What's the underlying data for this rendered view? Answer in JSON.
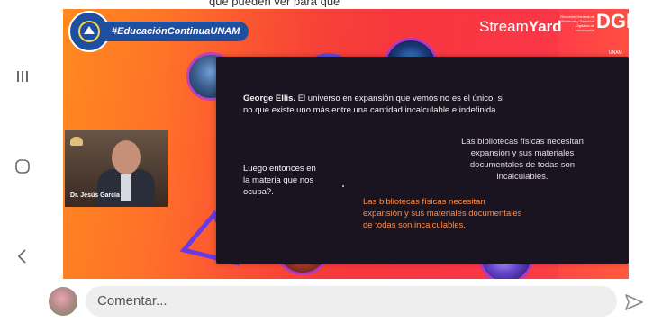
{
  "top_caption": "que pueden ver para que",
  "nav": {
    "recents_icon": "recent-apps-icon",
    "home_icon": "home-icon",
    "back_icon": "back-icon"
  },
  "stream": {
    "hashtag": "#EducaciónContinuaUNAM",
    "brand": "Stream",
    "brand_bold": "Yard",
    "dgb_text": "Dirección General de Bibliotecas y Servicios Digitales de Información",
    "dgb_logo": "DGB",
    "dgb_unam": "UNAM",
    "colors": {
      "orange": "#ff8a1f",
      "red": "#ff3d3d",
      "blue": "#1f4f9f",
      "slide_bg": "#1a1420"
    }
  },
  "slide": {
    "quote_author": "George Ellis.",
    "quote_body": " El universo en expansión que vemos no es el único, si no que existe uno más entre una cantidad incalculable e indefinida",
    "question": "Luego entonces en la materia que nos ocupa?.",
    "library_text_1": "Las bibliotecas físicas necesitan expansión y sus materiales documentales de todas son incalculables.",
    "library_text_2": "Las bibliotecas físicas necesitan expansión y sus materiales documentales de todas son incalculables."
  },
  "video_tile": {
    "speaker_name": "Dr. Jesús García"
  },
  "comment": {
    "placeholder": "Comentar...",
    "send_icon": "send-icon"
  }
}
